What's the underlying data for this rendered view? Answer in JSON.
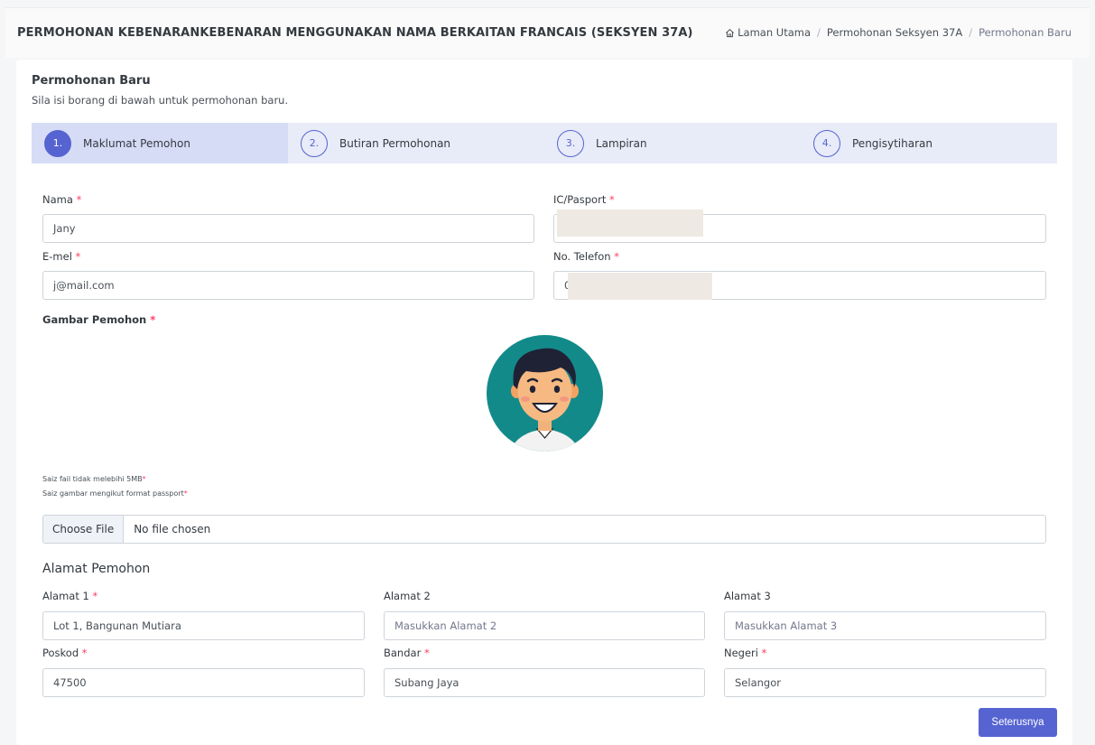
{
  "header": {
    "title": "PERMOHONAN KEBENARANKEBENARAN MENGGUNAKAN NAMA BERKAITAN FRANCAIS (SEKSYEN 37A)",
    "breadcrumb": [
      "Laman Utama",
      "Permohonan Seksyen 37A",
      "Permohonan Baru"
    ]
  },
  "card": {
    "title": "Permohonan Baru",
    "subtitle": "Sila isi borang di bawah untuk permohonan baru."
  },
  "steps": [
    {
      "num": "1.",
      "label": "Maklumat Pemohon"
    },
    {
      "num": "2.",
      "label": "Butiran Permohonan"
    },
    {
      "num": "3.",
      "label": "Lampiran"
    },
    {
      "num": "4.",
      "label": "Pengisytiharan"
    }
  ],
  "form": {
    "required_mark": "*",
    "nama": {
      "label": "Nama",
      "value": "Jany"
    },
    "ic": {
      "label": "IC/Pasport",
      "value": ""
    },
    "email": {
      "label": "E-mel",
      "value": "j@mail.com"
    },
    "phone": {
      "label": "No. Telefon",
      "value": "0"
    },
    "photo": {
      "label": "Gambar Pemohon",
      "note1": "Saiz fail tidak melebihi 5MB",
      "note2": "Saiz gambar mengikut format passport",
      "file_button": "Choose File",
      "file_status": "No file chosen"
    },
    "address_section": "Alamat Pemohon",
    "alamat1": {
      "label": "Alamat 1",
      "value": "Lot 1, Bangunan Mutiara"
    },
    "alamat2": {
      "label": "Alamat 2",
      "placeholder": "Masukkan Alamat 2"
    },
    "alamat3": {
      "label": "Alamat 3",
      "placeholder": "Masukkan Alamat 3"
    },
    "poskod": {
      "label": "Poskod",
      "value": "47500"
    },
    "bandar": {
      "label": "Bandar",
      "value": "Subang Jaya"
    },
    "negeri": {
      "label": "Negeri",
      "value": "Selangor"
    }
  },
  "actions": {
    "next": "Seterusnya"
  },
  "colors": {
    "primary": "#5664d2",
    "required": "#ff3d60",
    "stepper_bg": "#e8ebf8",
    "avatar_bg": "#138a8a"
  }
}
